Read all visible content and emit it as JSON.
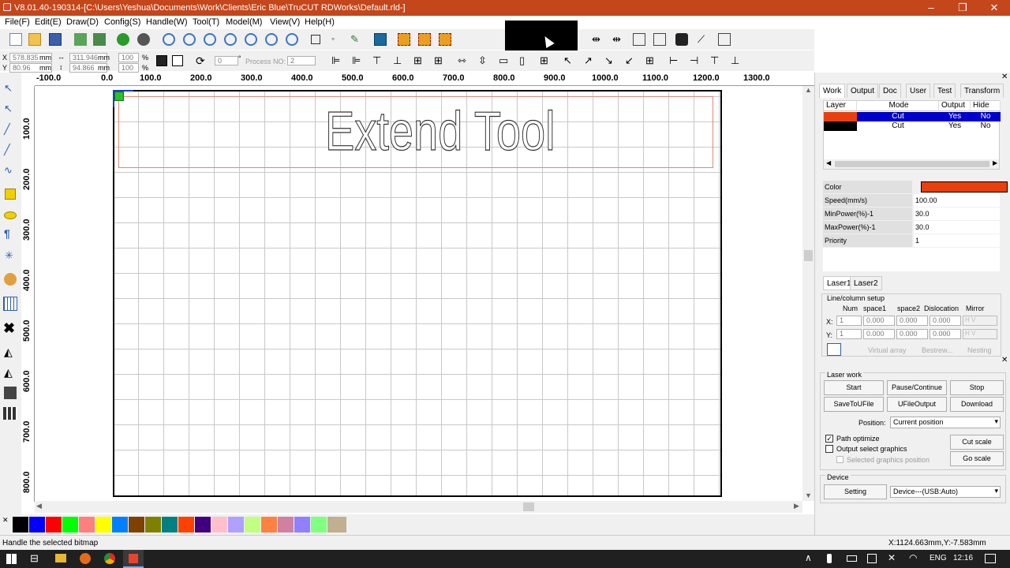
{
  "window": {
    "title": "V8.01.40-190314-[C:\\Users\\Yeshua\\Documents\\Work\\Clients\\Eric Blue\\TruCUT RDWorks\\Default.rld-]",
    "minimize": "–",
    "maximize": "❐",
    "close": "✕"
  },
  "menu": [
    "File(F)",
    "Edit(E)",
    "Draw(D)",
    "Config(S)",
    "Handle(W)",
    "Tool(T)",
    "Model(M)",
    "View(V)",
    "Help(H)"
  ],
  "coords": {
    "x_label": "X",
    "x_value": "578.835",
    "x_unit": "mm",
    "y_label": "Y",
    "y_value": "80.96",
    "y_unit": "mm",
    "w_value": "311.946",
    "w_unit": "mm",
    "h_value": "94.866",
    "h_unit": "mm",
    "scale_x": "100",
    "scale_y": "100",
    "pct": "%",
    "angle": "0",
    "deg": "°",
    "process_label": "Process NO:",
    "process_value": "2"
  },
  "ruler": {
    "h_labels": [
      "-100.0",
      "0.0",
      "100.0",
      "200.0",
      "300.0",
      "400.0",
      "500.0",
      "600.0",
      "700.0",
      "800.0",
      "900.0",
      "1000.0",
      "1100.0",
      "1200.0",
      "1300.0"
    ],
    "v_labels": [
      "100.0",
      "200.0",
      "300.0",
      "400.0",
      "500.0",
      "600.0",
      "700.0",
      "800.0"
    ]
  },
  "canvas": {
    "text": "Extend Tool"
  },
  "palette": [
    "#000000",
    "#0000ff",
    "#ff0000",
    "#00ff00",
    "#ff7f7f",
    "#ffff00",
    "#0080ff",
    "#804000",
    "#808000",
    "#008080",
    "#ff4000",
    "#400080",
    "#ffc0cb",
    "#b0a0ff",
    "#c0ff80",
    "#ff8040",
    "#d080a0",
    "#9080ff",
    "#80ff80",
    "#c0b090"
  ],
  "status": {
    "message": "Handle the selected bitmap",
    "coords": "X:1124.663mm,Y:-7.583mm"
  },
  "taskbar": {
    "lang": "ENG",
    "time": "12:16"
  },
  "tabs": [
    "Work",
    "Output",
    "Doc",
    "User",
    "Test",
    "Transform"
  ],
  "layers": {
    "headers": [
      "Layer",
      "Mode",
      "Output",
      "Hide"
    ],
    "rows": [
      {
        "color": "#e8400c",
        "mode": "Cut",
        "output": "Yes",
        "hide": "No",
        "selected": true
      },
      {
        "color": "#000000",
        "mode": "Cut",
        "output": "Yes",
        "hide": "No",
        "selected": false
      }
    ]
  },
  "props": [
    {
      "k": "Color",
      "v": ""
    },
    {
      "k": "Speed(mm/s)",
      "v": "100.00"
    },
    {
      "k": "MinPower(%)-1",
      "v": "30.0"
    },
    {
      "k": "MaxPower(%)-1",
      "v": "30.0"
    },
    {
      "k": "Priority",
      "v": "1"
    }
  ],
  "laser_tabs": [
    "Laser1",
    "Laser2"
  ],
  "linecol": {
    "title": "Line/column setup",
    "headers": [
      "Num",
      "space1",
      "space2",
      "Dislocation",
      "Mirror"
    ],
    "x_label": "X:",
    "y_label": "Y:",
    "num": "1",
    "val": "0.000",
    "h": "H",
    "v": "V",
    "virtual": "Virtual array",
    "bestrew": "Bestrew...",
    "nesting": "Nesting"
  },
  "laserwork": {
    "title": "Laser work",
    "start": "Start",
    "pause": "Pause/Continue",
    "stop": "Stop",
    "save": "SaveToUFile",
    "uout": "UFileOutput",
    "download": "Download",
    "position_label": "Position:",
    "position_value": "Current position",
    "path_opt": "Path optimize",
    "output_sel": "Output select graphics",
    "sel_pos": "Selected graphics position",
    "cut_scale": "Cut scale",
    "go_scale": "Go scale"
  },
  "device": {
    "title": "Device",
    "setting": "Setting",
    "value": "Device---(USB:Auto)"
  }
}
